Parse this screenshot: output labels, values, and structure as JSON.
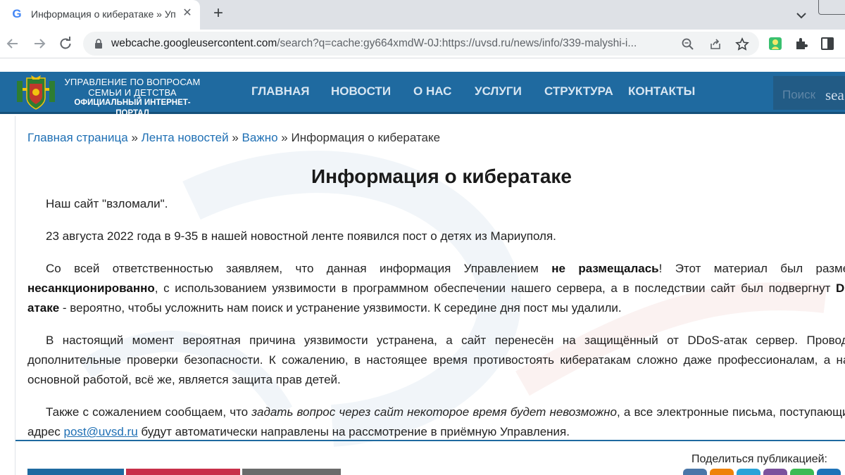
{
  "browser": {
    "tab_title": "Информация о кибератаке » Уп",
    "tab_close": "✕",
    "new_tab": "+",
    "favicon_letter": "G",
    "url_host": "webcache.googleusercontent.com",
    "url_rest": "/search?q=cache:gy664xmdW-0J:https://uvsd.ru/news/info/339-malyshi-i..."
  },
  "site": {
    "org_line1": "Управление по вопросам",
    "org_line2": "семьи и детства",
    "org_line3": "официальный интернет-портал",
    "nav": [
      "ГЛАВНАЯ",
      "НОВОСТИ",
      "О НАС",
      "УСЛУГИ",
      "СТРУКТУРА",
      "КОНТАКТЫ"
    ],
    "search_placeholder": "Поиск",
    "search_button": "sea"
  },
  "breadcrumb": {
    "home": "Главная страница",
    "news": "Лента новостей",
    "important": "Важно",
    "current": "Информация о кибератаке",
    "sep": "»"
  },
  "article": {
    "title": "Информация о кибератаке",
    "p1": "Наш сайт \"взломали\".",
    "p2": "23 августа 2022 года в 9-35 в нашей новостной ленте появился пост о детях из Мариуполя.",
    "p3_a": "Со всей ответственностью заявляем, что данная информация Управлением ",
    "p3_b": "не размещалась",
    "p3_c": "! Этот материал был размещён ",
    "p3_d": "несанкционированно",
    "p3_e": ", с использованием уязвимости в программном обеспечении нашего сервера, а в последствии сайт был подвергнут ",
    "p3_f": "DDoS-атаке",
    "p3_g": " - вероятно, чтобы усложнить нам поиск и устранение уязвимости. К середине дня пост мы удалили.",
    "p4": "В настоящий момент вероятная причина уязвимости устранена, а сайт перенесён на защищённый от DDoS-атак сервер. Проводятся дополнительные проверки безопасности. К сожалению, в настоящее время противостоять кибератакам сложно даже профессионалам, а нашей основной работой, всё же, является защита прав детей.",
    "p5_a": "Также с сожалением сообщаем, что ",
    "p5_b": "задать вопрос через сайт некоторое время будет невозможно",
    "p5_c": ", а все электронные письма, поступающие на адрес ",
    "p5_email": "post@uvsd.ru",
    "p5_d": " будут автоматически направлены на рассмотрение в приёмную Управления."
  },
  "share": {
    "label": "Поделиться публикацией:",
    "buttons": [
      {
        "name": "vk",
        "color": "#4a76a8"
      },
      {
        "name": "ok",
        "color": "#ee8208"
      },
      {
        "name": "telegram",
        "color": "#2aa3d8"
      },
      {
        "name": "viber",
        "color": "#7b519d"
      },
      {
        "name": "whatsapp",
        "color": "#3cba54"
      },
      {
        "name": "mail",
        "color": "#1e73b8"
      }
    ]
  },
  "bottom_buttons": [
    {
      "color": "#1f6aa0"
    },
    {
      "color": "#c8304a"
    },
    {
      "color": "#6b6b6b"
    }
  ]
}
